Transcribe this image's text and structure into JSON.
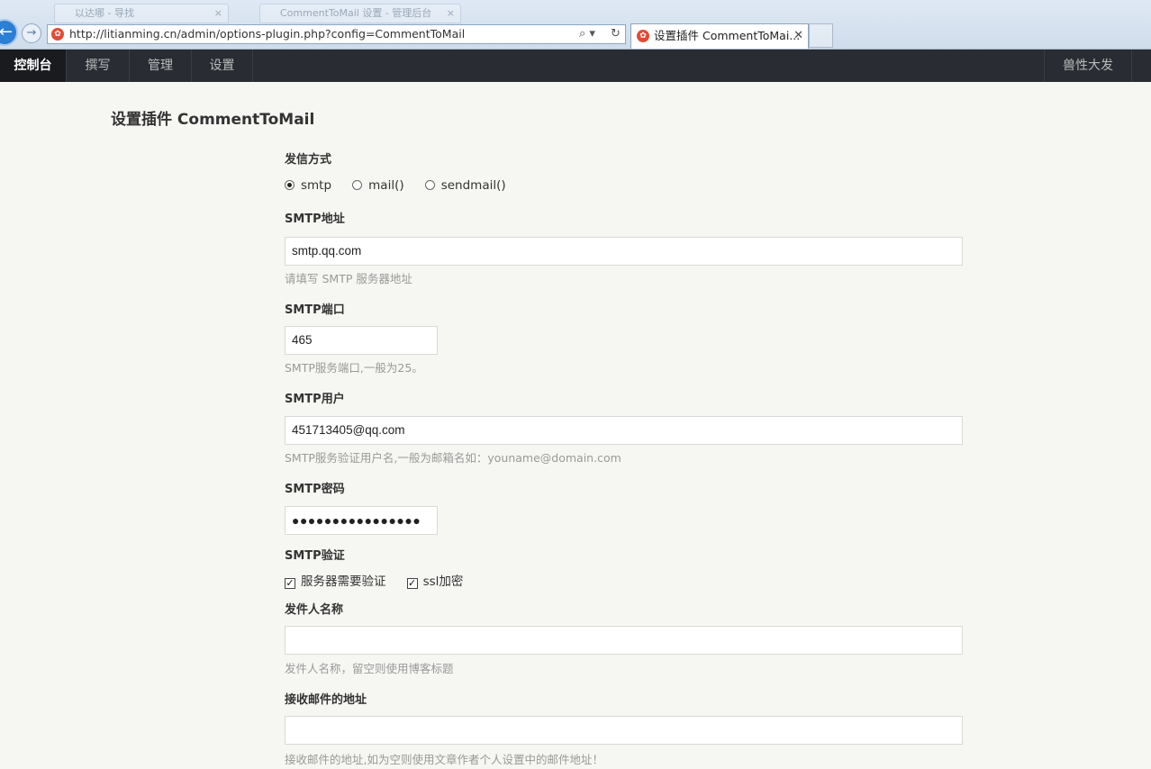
{
  "browser": {
    "ghost_tabs": [
      "以达哪 - 导找",
      "CommentToMail 设置 - 管理后台"
    ],
    "ghost_close": "×",
    "url": "http://litianming.cn/admin/options-plugin.php?config=CommentToMail",
    "addr_controls": [
      "⌕ ▾",
      "↻"
    ],
    "tab_title": "设置插件 CommentToMai...",
    "tab_close": "✕"
  },
  "nav": {
    "items": [
      "控制台",
      "撰写",
      "管理",
      "设置"
    ],
    "active_index": 0,
    "user": "兽性大发"
  },
  "page": {
    "title": "设置插件 CommentToMail"
  },
  "form": {
    "send_method": {
      "label": "发信方式",
      "options": [
        "smtp",
        "mail()",
        "sendmail()"
      ],
      "selected": "smtp"
    },
    "smtp_host": {
      "label": "SMTP地址",
      "value": "smtp.qq.com",
      "desc": "请填写 SMTP 服务器地址"
    },
    "smtp_port": {
      "label": "SMTP端口",
      "value": "465",
      "desc": "SMTP服务端口,一般为25。"
    },
    "smtp_user": {
      "label": "SMTP用户",
      "value": "451713405@qq.com",
      "desc": "SMTP服务验证用户名,一般为邮箱名如：youname@domain.com"
    },
    "smtp_pass": {
      "label": "SMTP密码",
      "value": "●●●●●●●●●●●●●●●●"
    },
    "smtp_verify": {
      "label": "SMTP验证",
      "options": [
        {
          "label": "服务器需要验证",
          "checked": true
        },
        {
          "label": "ssl加密",
          "checked": true
        }
      ]
    },
    "sender_name": {
      "label": "发件人名称",
      "value": "",
      "desc": "发件人名称，留空则使用博客标题"
    },
    "recv_addr": {
      "label": "接收邮件的地址",
      "value": "",
      "desc": "接收邮件的地址,如为空则使用文章作者个人设置中的邮件地址！"
    }
  },
  "colors": {
    "nav_bg": "#292d33",
    "nav_active_bg": "#191b1f",
    "page_bg": "#f6f6f3",
    "favicon": "#e14b35"
  }
}
